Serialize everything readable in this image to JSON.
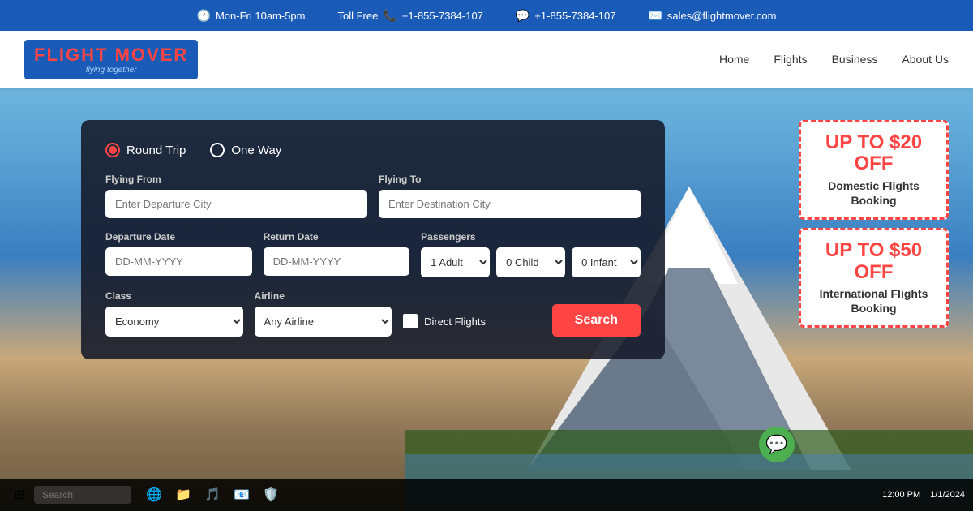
{
  "topbar": {
    "hours": "Mon-Fri 10am-5pm",
    "tollfree_label": "Toll Free",
    "phone1": "+1-855-7384-107",
    "phone2": "+1-855-7384-107",
    "email": "sales@flightmover.com"
  },
  "header": {
    "logo_text_part1": "FLIGHT",
    "logo_text_part2": "MOVER",
    "tagline": "flying together",
    "nav": {
      "home": "Home",
      "flights": "Flights",
      "business": "Business",
      "about": "About Us"
    }
  },
  "search": {
    "trip_type_round": "Round Trip",
    "trip_type_oneway": "One Way",
    "flying_from_label": "Flying From",
    "flying_from_placeholder": "Enter Departure City",
    "flying_to_label": "Flying To",
    "flying_to_placeholder": "Enter Destination City",
    "departure_label": "Departure Date",
    "departure_placeholder": "DD-MM-YYYY",
    "return_label": "Return Date",
    "return_placeholder": "DD-MM-YYYY",
    "passengers_label": "Passengers",
    "adult_default": "1 Adult",
    "child_default": "0 Child",
    "infant_default": "0 Infant",
    "class_label": "Class",
    "class_default": "Economy",
    "airline_label": "Airline",
    "airline_default": "Any Airline",
    "direct_label": "Direct Flights",
    "search_button": "Search"
  },
  "promo": {
    "domestic_amount": "UP TO $20 OFF",
    "domestic_desc": "Domestic Flights Booking",
    "international_amount": "UP TO $50 OFF",
    "international_desc": "International Flights Booking"
  },
  "taskbar": {
    "search_placeholder": "Search"
  }
}
